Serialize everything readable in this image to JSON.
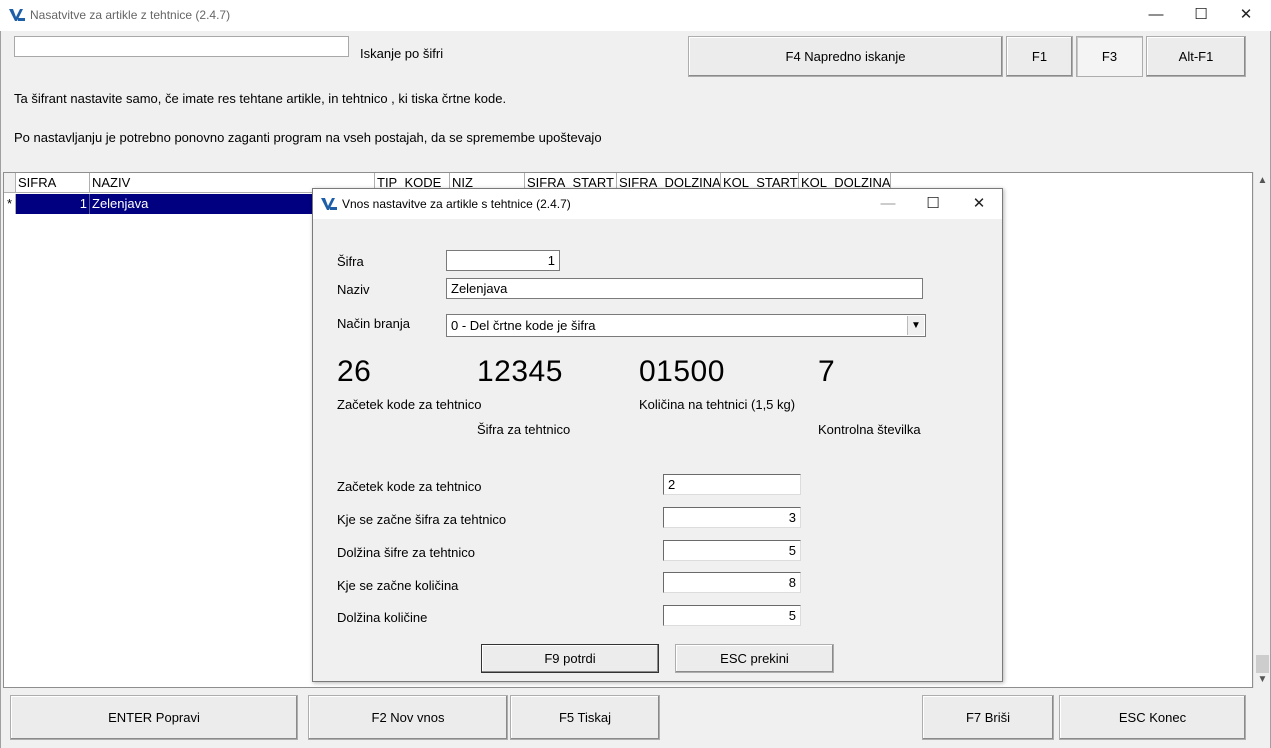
{
  "window": {
    "title": "Nasatvitve za artikle z tehtnice  (2.4.7)",
    "minimize": "—",
    "maximize": "☐",
    "close": "✕"
  },
  "search": {
    "value": "",
    "label": "Iskanje po šifri"
  },
  "top_buttons": {
    "f4": "F4  Napredno iskanje",
    "f1": "F1",
    "f3": "F3",
    "altf1": "Alt-F1"
  },
  "info": {
    "line1": "Ta šifrant nastavite samo, če imate res tehtane artikle, in tehtnico , ki tiska črtne kode.",
    "line2": "Po nastavljanju je potrebno ponovno zaganti program na vseh postajah, da se spremembe   upoštevajo"
  },
  "grid": {
    "columns": [
      "SIFRA",
      "NAZIV",
      "TIP_KODE",
      "NIZ",
      "SIFRA_START",
      "SIFRA_DOLZINA",
      "KOL_START",
      "KOL_DOLZINA"
    ],
    "rows": [
      {
        "marker": "*",
        "sifra": "1",
        "naziv": "Zelenjava"
      }
    ]
  },
  "scrollbar": {
    "up": "▲",
    "down": "▼"
  },
  "bottom_buttons": {
    "enter": "ENTER Popravi",
    "f2": "F2 Nov vnos",
    "f5": "F5 Tiskaj",
    "f7": "F7 Briši",
    "esc": "ESC Konec"
  },
  "dialog": {
    "title": "Vnos nastavitve za artikle s tehtnice  (2.4.7)",
    "minimize": "—",
    "maximize": "☐",
    "close": "✕",
    "sifra_label": "Šifra",
    "sifra_value": "1",
    "naziv_label": "Naziv",
    "naziv_value": "Zelenjava",
    "nacin_label": "Način branja",
    "nacin_value": "0 - Del črtne kode je šifra",
    "combo_arrow": "▼",
    "example": {
      "part1": "26",
      "part2": "12345",
      "part3": "01500",
      "part4": "7",
      "cap1": "Začetek kode za tehtnico",
      "cap2": "Šifra za tehtnico",
      "cap3": "Količina na tehtnici  (1,5 kg)",
      "cap4": "Kontrolna številka"
    },
    "params": [
      {
        "label": "Začetek kode za tehtnico",
        "value": "2"
      },
      {
        "label": "Kje se začne šifra za tehtnico",
        "value": "3"
      },
      {
        "label": "Dolžina šifre za tehtnico",
        "value": "5"
      },
      {
        "label": "Kje se začne količina",
        "value": "8"
      },
      {
        "label": "Dolžina količine",
        "value": "5"
      }
    ],
    "confirm": "F9  potrdi",
    "cancel": "ESC  prekini"
  },
  "colors": {
    "selection": "#000080",
    "app_icon": "#1f5fa8"
  }
}
